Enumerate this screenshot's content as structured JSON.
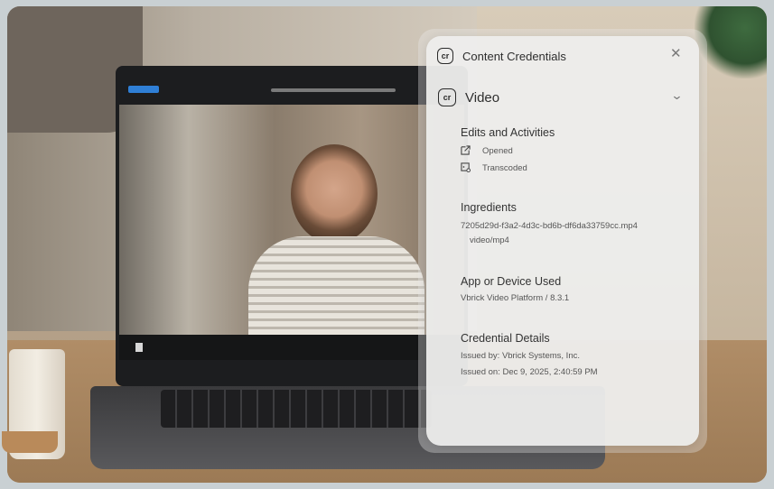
{
  "panel": {
    "badge": "cr",
    "title": "Content Credentials",
    "close_icon": "close-icon",
    "section_title": "Video",
    "chevron_icon": "chevron-down-icon",
    "edits": {
      "heading": "Edits and Activities",
      "items": [
        {
          "icon": "open-external-icon",
          "label": "Opened"
        },
        {
          "icon": "transcode-icon",
          "label": "Transcoded"
        }
      ]
    },
    "ingredients": {
      "heading": "Ingredients",
      "file": "7205d29d-f3a2-4d3c-bd6b-df6da33759cc.mp4",
      "type": "video/mp4"
    },
    "app": {
      "heading": "App or Device Used",
      "value": "Vbrick Video Platform / 8.3.1"
    },
    "credential": {
      "heading": "Credential Details",
      "issued_by": "Issued by: Vbrick Systems, Inc.",
      "issued_on": "Issued on: Dec 9, 2025, 2:40:59 PM"
    }
  },
  "colors": {
    "panel_bg": "#eeeeed",
    "text": "#333333",
    "player_accent": "#2f7fd6"
  }
}
